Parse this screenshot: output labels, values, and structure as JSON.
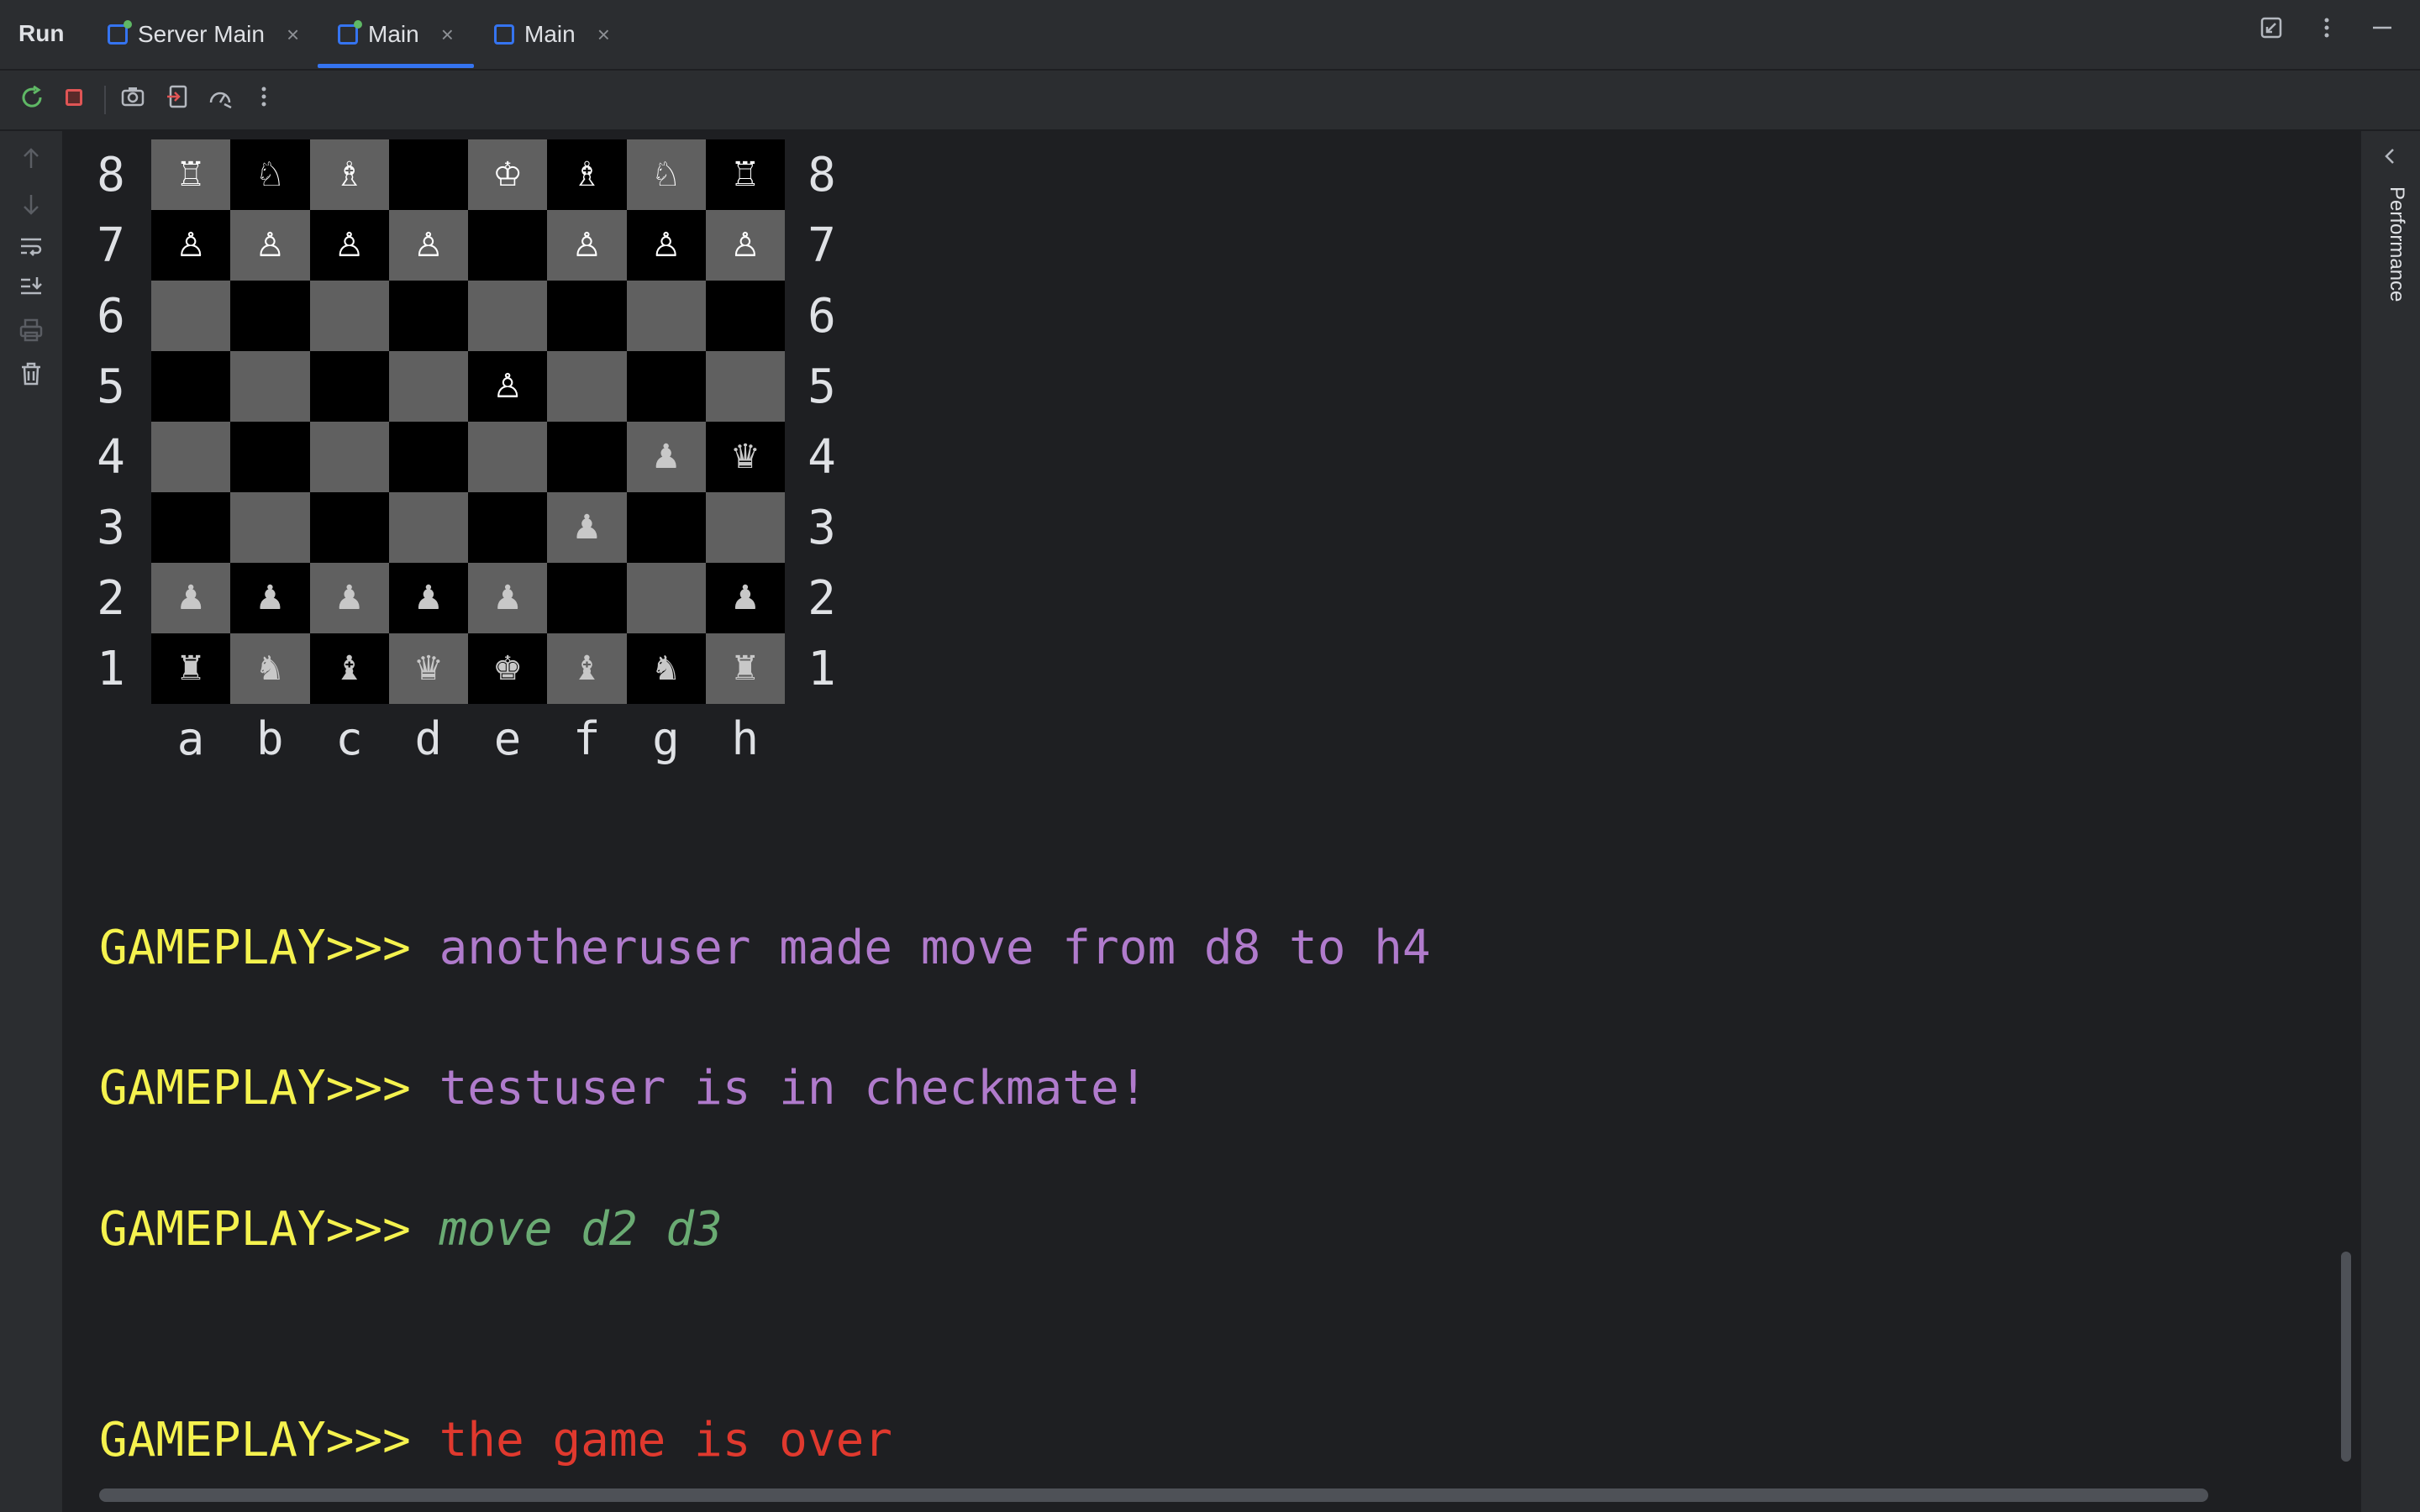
{
  "header": {
    "title": "Run",
    "tabs": [
      {
        "label": "Server Main",
        "active": false
      },
      {
        "label": "Main",
        "active": true
      },
      {
        "label": "Main",
        "active": false
      }
    ],
    "close_glyph": "×",
    "right_icons": [
      "restore-icon",
      "more-icon",
      "minimize-icon"
    ]
  },
  "toolbar": {
    "icons": [
      "rerun-icon",
      "stop-icon",
      "screenshot-icon",
      "exit-icon",
      "profiler-icon",
      "more-icon"
    ]
  },
  "gutter": {
    "icons": [
      "up-arrow-icon",
      "down-arrow-icon",
      "soft-wrap-icon",
      "scroll-to-end-icon",
      "print-icon",
      "trash-icon"
    ]
  },
  "sidebar": {
    "performance_label": "Performance"
  },
  "board": {
    "ranks": [
      "8",
      "7",
      "6",
      "5",
      "4",
      "3",
      "2",
      "1"
    ],
    "files": [
      "a",
      "b",
      "c",
      "d",
      "e",
      "f",
      "g",
      "h"
    ],
    "rows": [
      [
        "♖",
        "♘",
        "♗",
        "",
        "♔",
        "♗",
        "♘",
        "♖"
      ],
      [
        "♙",
        "♙",
        "♙",
        "♙",
        "",
        "♙",
        "♙",
        "♙"
      ],
      [
        "",
        "",
        "",
        "",
        "",
        "",
        "",
        ""
      ],
      [
        "",
        "",
        "",
        "",
        "♙",
        "",
        "",
        ""
      ],
      [
        "",
        "",
        "",
        "",
        "",
        "",
        "♟",
        "♛"
      ],
      [
        "",
        "",
        "",
        "",
        "",
        "♟",
        "",
        ""
      ],
      [
        "♟",
        "♟",
        "♟",
        "♟",
        "♟",
        "",
        "",
        "♟"
      ],
      [
        "♜",
        "♞",
        "♝",
        "♛",
        "♚",
        "♝",
        "♞",
        "♜"
      ]
    ]
  },
  "log": [
    {
      "prompt": "GAMEPLAY>>> ",
      "text": "anotheruser made move from d8 to h4",
      "style": "purple"
    },
    {
      "prompt": "GAMEPLAY>>> ",
      "text": "testuser is in checkmate!",
      "style": "purple"
    },
    {
      "prompt": "GAMEPLAY>>> ",
      "text": "move d2 d3",
      "style": "green"
    },
    {
      "prompt": "GAMEPLAY>>> ",
      "text": "the game is over",
      "style": "red"
    }
  ],
  "colors": {
    "prompt": "#f5f24e",
    "purple": "#b07bcc",
    "green": "#6aab73",
    "red": "#e0392e",
    "accent": "#3574f0"
  }
}
